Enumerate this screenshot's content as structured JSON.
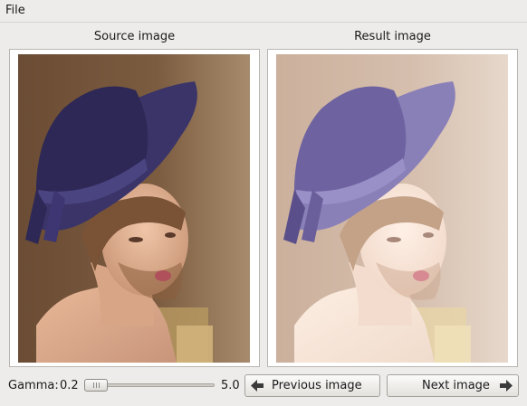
{
  "menubar": {
    "file_label": "File"
  },
  "panels": {
    "source_title": "Source image",
    "result_title": "Result image"
  },
  "controls": {
    "gamma_label": "Gamma:",
    "gamma_min": "0.2",
    "gamma_max": "5.0",
    "gamma_position": 0.0,
    "previous_label": "Previous image",
    "next_label": "Next image"
  },
  "icons": {
    "previous": "arrow-left-icon",
    "next": "arrow-right-icon"
  },
  "colors": {
    "window_bg": "#edeceb",
    "hat_source": "#3a3468",
    "hat_result": "#8a80b8"
  }
}
